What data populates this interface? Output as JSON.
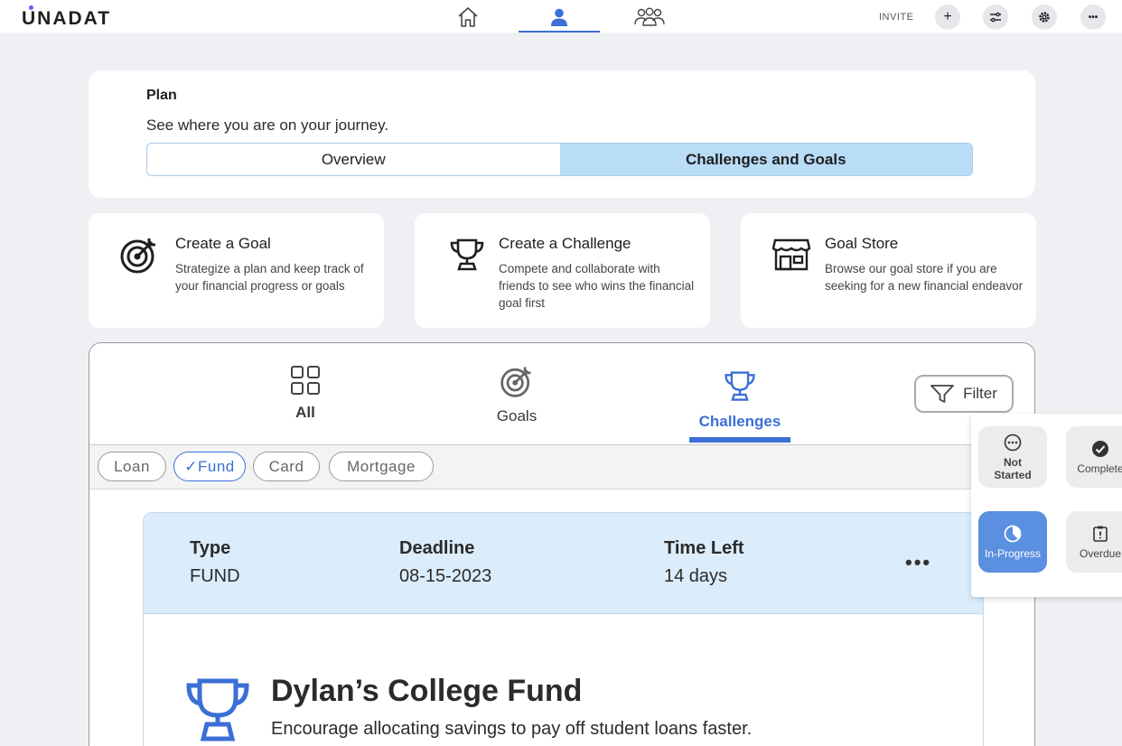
{
  "app": {
    "logo": "UNADAT"
  },
  "header": {
    "invite_label": "INVITE",
    "plus": "+",
    "more": "•••"
  },
  "plan": {
    "title": "Plan",
    "subtitle": "See where you are on your journey.",
    "tabs": [
      {
        "label": "Overview",
        "active": false
      },
      {
        "label": "Challenges and Goals",
        "active": true
      }
    ]
  },
  "actions": [
    {
      "title": "Create a Goal",
      "description": "Strategize a plan and keep track of your financial progress or goals",
      "icon": "target-icon"
    },
    {
      "title": "Create a Challenge",
      "description": "Compete and collaborate with friends to see who wins the financial goal first",
      "icon": "trophy-icon"
    },
    {
      "title": "Goal Store",
      "description": "Browse our goal store if you are seeking for a new financial endeavor",
      "icon": "store-icon"
    }
  ],
  "list": {
    "tabs": [
      {
        "label": "All"
      },
      {
        "label": "Goals"
      },
      {
        "label": "Challenges",
        "active": true
      }
    ],
    "filter_label": "Filter",
    "chips": [
      {
        "label": "Loan"
      },
      {
        "label": "✓Fund",
        "selected": true
      },
      {
        "label": "Card"
      },
      {
        "label": "Mortgage"
      }
    ]
  },
  "goal": {
    "type_label": "Type",
    "type_value": "FUND",
    "deadline_label": "Deadline",
    "deadline_value": "08-15-2023",
    "time_left_label": "Time Left",
    "time_left_value": "14 days",
    "more": "•••",
    "title": "Dylan’s College Fund",
    "description": "Encourage allocating savings to pay off student loans faster."
  },
  "status_filter": {
    "items": [
      {
        "label": "Not Started",
        "icon": "dots-circle-icon"
      },
      {
        "label": "Complete",
        "icon": "check-circle-icon"
      },
      {
        "label": "In-Progress",
        "icon": "pie-clock-icon",
        "active": true
      },
      {
        "label": "Overdue",
        "icon": "alert-clipboard-icon"
      }
    ]
  },
  "colors": {
    "accent": "#3b6fd6",
    "highlight": "#b9dcf7",
    "status_active": "#5b8fe0"
  }
}
